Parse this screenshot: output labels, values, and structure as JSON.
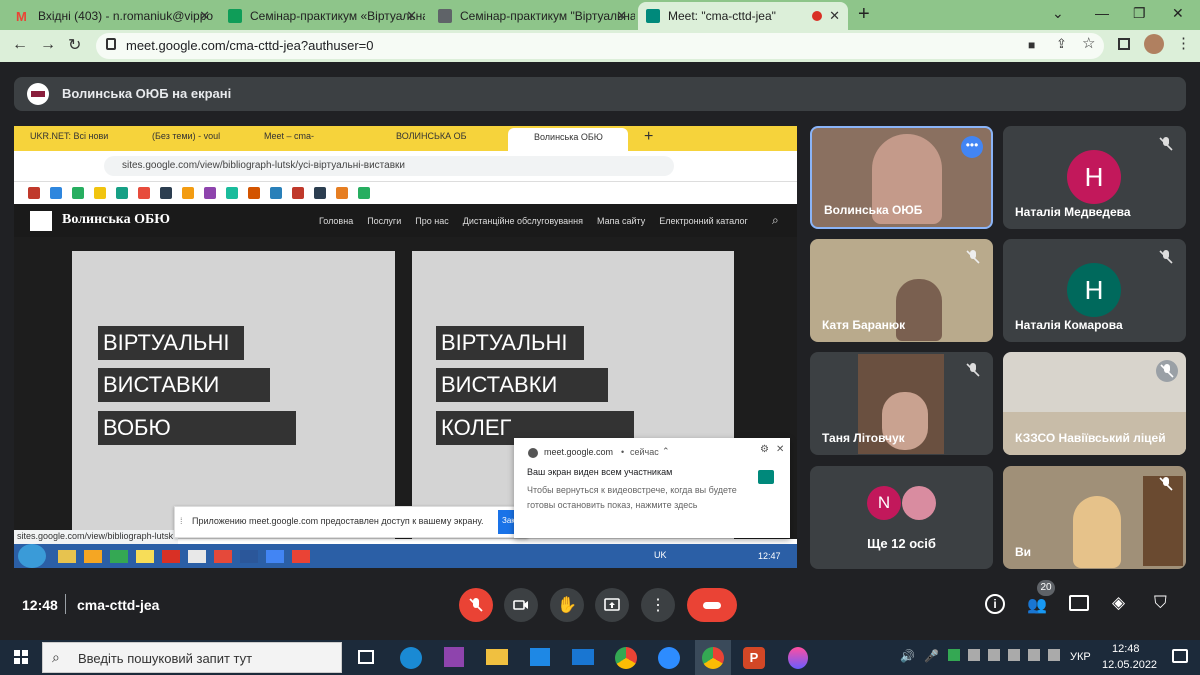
{
  "browser": {
    "tabs": [
      {
        "title": "Вхідні (403) - n.romaniuk@vippo",
        "icon": "gmail-icon",
        "color": "#ea4335"
      },
      {
        "title": "Семінар-практикум «Віртуальна",
        "icon": "sheets-icon",
        "color": "#0f9d58"
      },
      {
        "title": "Семінар-практикум \"Віртуальна",
        "icon": "doc-icon",
        "color": "#5f6368"
      },
      {
        "title": "Meet: \"cma-cttd-jea\"",
        "icon": "meet-icon",
        "color": "#00897b"
      }
    ],
    "url": "meet.google.com/cma-cttd-jea?authuser=0"
  },
  "presentation": {
    "title": "Волинська ОЮБ на екрані"
  },
  "shared_screen": {
    "tabs": [
      "UKR.NET: Всі нови",
      "(Без теми) - voul",
      "Meet – cma-",
      "ВОЛИНСЬКА ОБ",
      "Волинська ОБЮ"
    ],
    "url": "sites.google.com/view/bibliograph-lutsk/усі-віртуальні-виставки",
    "site_name": "Волинська ОБЮ",
    "nav": [
      "Головна",
      "Послуги",
      "Про нас",
      "Дистанційне обслуговування",
      "Мапа сайту",
      "Електронний каталог"
    ],
    "card1_lines": [
      "ВІРТУАЛЬНІ",
      "ВИСТАВКИ",
      "ВОБЮ"
    ],
    "card2_lines": [
      "ВІРТУАЛЬНІ",
      "ВИСТАВКИ",
      "КОЛЕГ"
    ],
    "status_url": "sites.google.com/view/bibliograph-lutsk",
    "share_bar_text": "Приложению meet.google.com предоставлен доступ к вашему экрану.",
    "share_bar_btn": "Закрыть доступ",
    "notif": {
      "source": "meet.google.com",
      "when": "сейчас",
      "title": "Ваш экран виден всем участникам",
      "body": "Чтобы вернуться к видеовстрече, когда вы будете готовы остановить показ, нажмите здесь"
    },
    "inner_lang": "UK",
    "inner_time": "12:47"
  },
  "participants": [
    {
      "name": "Волинська ОЮБ",
      "type": "video",
      "color": "#8a7060"
    },
    {
      "name": "Наталія Медведева",
      "type": "avatar",
      "initial": "Н",
      "color": "#c2185b"
    },
    {
      "name": "Катя Баранюк",
      "type": "video",
      "color": "#b9aa8c"
    },
    {
      "name": "Наталія Комарова",
      "type": "avatar",
      "initial": "Н",
      "color": "#00695c"
    },
    {
      "name": "Таня Літовчук",
      "type": "video",
      "color": "#6a5040"
    },
    {
      "name": "КЗЗСО Навіївський ліцей",
      "type": "video",
      "color": "#d8d4cc"
    },
    {
      "name": "Ще 12 осіб",
      "type": "more",
      "initial": "N",
      "color": "#c2185b"
    },
    {
      "name": "Ви",
      "type": "video",
      "color": "#a09078"
    }
  ],
  "meeting": {
    "time": "12:48",
    "code": "cma-cttd-jea",
    "participant_count": "20"
  },
  "taskbar": {
    "search_placeholder": "Введіть пошуковий запит тут",
    "lang": "УКР",
    "time": "12:48",
    "date": "12.05.2022"
  }
}
